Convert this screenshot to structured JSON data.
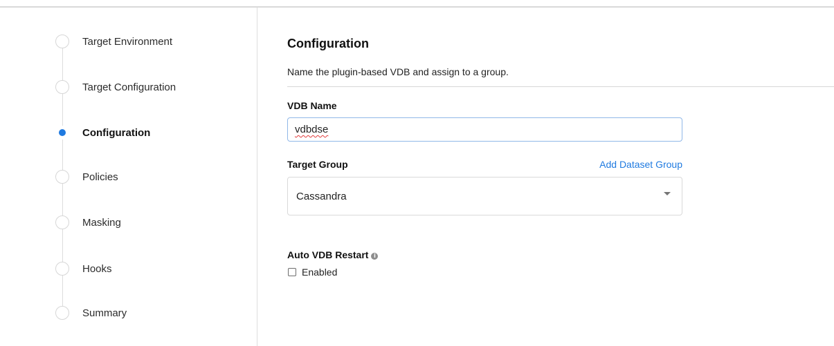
{
  "steps": [
    {
      "label": "Target Environment",
      "active": false
    },
    {
      "label": "Target Configuration",
      "active": false
    },
    {
      "label": "Configuration",
      "active": true
    },
    {
      "label": "Policies",
      "active": false
    },
    {
      "label": "Masking",
      "active": false
    },
    {
      "label": "Hooks",
      "active": false
    },
    {
      "label": "Summary",
      "active": false
    }
  ],
  "main": {
    "title": "Configuration",
    "subtitle": "Name the plugin-based VDB and assign to a group.",
    "vdb_name": {
      "label": "VDB Name",
      "value": "vdbdse"
    },
    "target_group": {
      "label": "Target Group",
      "add_link": "Add Dataset Group",
      "selected": "Cassandra"
    },
    "auto_restart": {
      "label": "Auto VDB Restart",
      "info_icon": "info-icon",
      "checkbox_label": "Enabled",
      "checked": false
    }
  },
  "colors": {
    "accent": "#1f7ae0",
    "input_focus_border": "#8fb7e8"
  }
}
